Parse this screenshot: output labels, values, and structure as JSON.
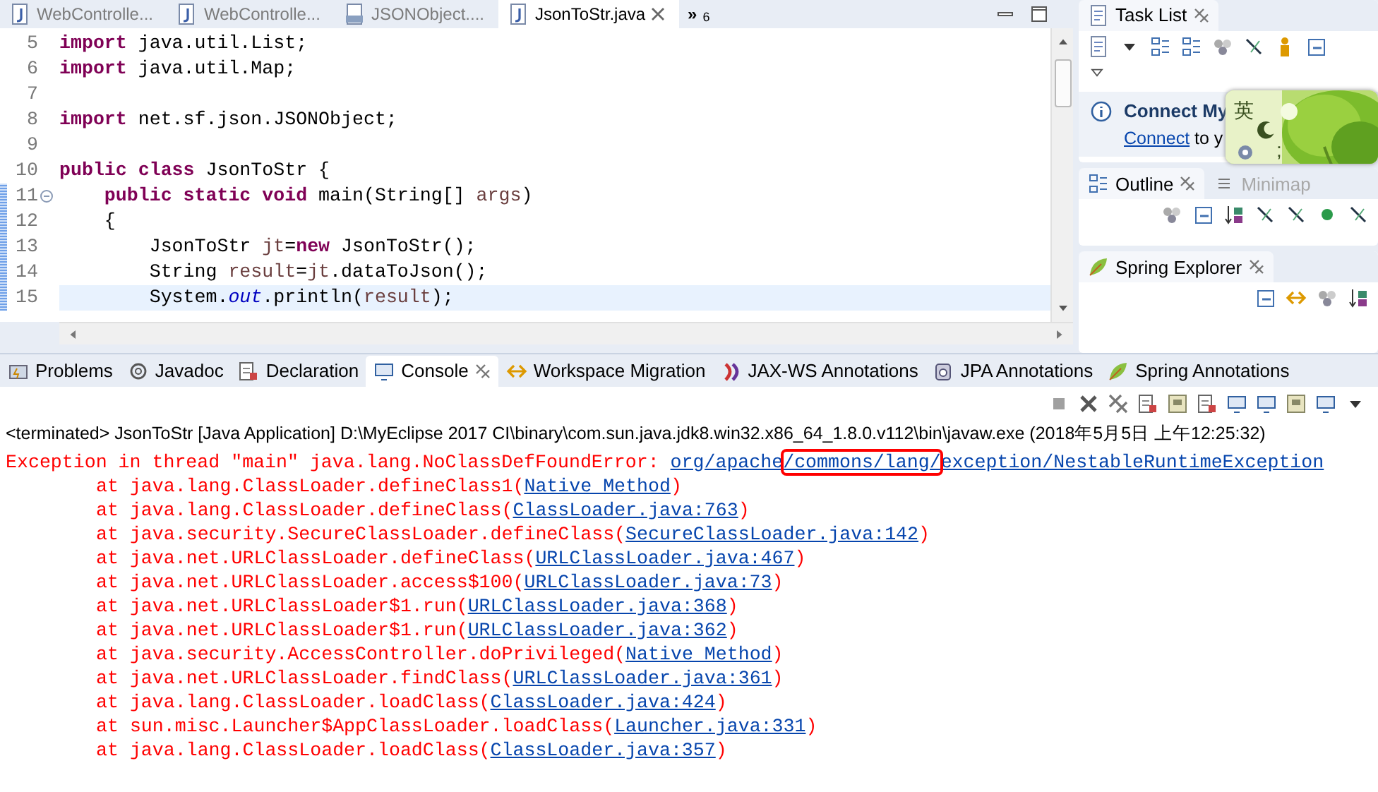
{
  "editor": {
    "tabs": [
      {
        "label": "WebControlle...",
        "selected": false,
        "closable": false
      },
      {
        "label": "WebControlle...",
        "selected": false,
        "closable": false
      },
      {
        "label": "JSONObject....",
        "selected": false,
        "closable": false
      },
      {
        "label": "JsonToStr.java",
        "selected": true,
        "closable": true
      }
    ],
    "overflow": {
      "symbol": "»",
      "count": "6"
    },
    "lines": [
      {
        "number": "5",
        "changed": false,
        "current": false,
        "foldable": false,
        "segments": [
          {
            "text": "import",
            "kind": "keyword"
          },
          {
            "text": " java.util.List;",
            "kind": "plain"
          }
        ]
      },
      {
        "number": "6",
        "changed": false,
        "current": false,
        "foldable": false,
        "segments": [
          {
            "text": "import",
            "kind": "keyword"
          },
          {
            "text": " java.util.Map;",
            "kind": "plain"
          }
        ]
      },
      {
        "number": "7",
        "changed": false,
        "current": false,
        "foldable": false
      },
      {
        "number": "8",
        "changed": false,
        "current": false,
        "foldable": false,
        "segments": [
          {
            "text": "import",
            "kind": "keyword"
          },
          {
            "text": " net.sf.json.JSONObject;",
            "kind": "plain"
          }
        ]
      },
      {
        "number": "9",
        "changed": false,
        "current": false,
        "foldable": false
      },
      {
        "number": "10",
        "changed": false,
        "current": false,
        "foldable": false,
        "segments": [
          {
            "text": "public class",
            "kind": "keyword"
          },
          {
            "text": " JsonToStr {",
            "kind": "plain"
          }
        ]
      },
      {
        "number": "11",
        "changed": true,
        "current": false,
        "foldable": true,
        "segments": [
          {
            "text": "    public static void",
            "kind": "keyword"
          },
          {
            "text": " main(String[] ",
            "kind": "plain"
          },
          {
            "text": "args",
            "kind": "variable"
          },
          {
            "text": ")",
            "kind": "plain"
          }
        ]
      },
      {
        "number": "12",
        "changed": true,
        "current": false,
        "foldable": false,
        "segments": [
          {
            "text": "    {",
            "kind": "plain"
          }
        ]
      },
      {
        "number": "13",
        "changed": true,
        "current": false,
        "foldable": false,
        "segments": [
          {
            "text": "        JsonToStr ",
            "kind": "plain"
          },
          {
            "text": "jt",
            "kind": "variable"
          },
          {
            "text": "=",
            "kind": "plain"
          },
          {
            "text": "new",
            "kind": "keyword"
          },
          {
            "text": " JsonToStr();",
            "kind": "plain"
          }
        ]
      },
      {
        "number": "14",
        "changed": true,
        "current": false,
        "foldable": false,
        "segments": [
          {
            "text": "        String ",
            "kind": "plain"
          },
          {
            "text": "result",
            "kind": "variable"
          },
          {
            "text": "=",
            "kind": "plain"
          },
          {
            "text": "jt",
            "kind": "variable"
          },
          {
            "text": ".dataToJson();",
            "kind": "plain"
          }
        ]
      },
      {
        "number": "15",
        "changed": true,
        "current": true,
        "foldable": false,
        "segments": [
          {
            "text": "        System.",
            "kind": "plain"
          },
          {
            "text": "out",
            "kind": "field"
          },
          {
            "text": ".println(",
            "kind": "plain"
          },
          {
            "text": "result",
            "kind": "variable"
          },
          {
            "text": ");",
            "kind": "plain"
          }
        ]
      }
    ]
  },
  "side": {
    "task_list": {
      "tab": "Task List",
      "connect_title": "Connect My",
      "connect_link": "Connect",
      "connect_rest": "to y"
    },
    "outline_tabs": [
      {
        "label": "Outline",
        "selected": true
      },
      {
        "label": "Minimap",
        "selected": false
      }
    ],
    "spring_explorer": {
      "tab": "Spring Explorer"
    }
  },
  "ime_widget": {
    "label": "英",
    "punct": ";"
  },
  "bottom": {
    "tabs": [
      {
        "label": "Problems",
        "selected": false
      },
      {
        "label": "Javadoc",
        "selected": false
      },
      {
        "label": "Declaration",
        "selected": false
      },
      {
        "label": "Console",
        "selected": true
      },
      {
        "label": "Workspace Migration",
        "selected": false
      },
      {
        "label": "JAX-WS Annotations",
        "selected": false
      },
      {
        "label": "JPA Annotations",
        "selected": false
      },
      {
        "label": "Spring Annotations",
        "selected": false
      }
    ],
    "console_title": "<terminated> JsonToStr [Java Application] D:\\MyEclipse 2017 CI\\binary\\com.sun.java.jdk8.win32.x86_64_1.8.0.v112\\bin\\javaw.exe (2018年5月5日 上午12:25:32)",
    "exception": {
      "text": "Exception in thread \"main\" java.lang.NoClassDefFoundError: ",
      "link": [
        {
          "text": "org/apache",
          "boxed": false
        },
        {
          "text": "/commons/lang/",
          "boxed": true
        },
        {
          "text": "exception/NestableRuntimeException",
          "boxed": false
        }
      ]
    },
    "frames": [
      {
        "text": "at java.lang.ClassLoader.defineClass1(",
        "link": "Native Method",
        "tail": ")"
      },
      {
        "text": "at java.lang.ClassLoader.defineClass(",
        "link": "ClassLoader.java:763",
        "tail": ")"
      },
      {
        "text": "at java.security.SecureClassLoader.defineClass(",
        "link": "SecureClassLoader.java:142",
        "tail": ")"
      },
      {
        "text": "at java.net.URLClassLoader.defineClass(",
        "link": "URLClassLoader.java:467",
        "tail": ")"
      },
      {
        "text": "at java.net.URLClassLoader.access$100(",
        "link": "URLClassLoader.java:73",
        "tail": ")"
      },
      {
        "text": "at java.net.URLClassLoader$1.run(",
        "link": "URLClassLoader.java:368",
        "tail": ")"
      },
      {
        "text": "at java.net.URLClassLoader$1.run(",
        "link": "URLClassLoader.java:362",
        "tail": ")"
      },
      {
        "text": "at java.security.AccessController.doPrivileged(",
        "link": "Native Method",
        "tail": ")"
      },
      {
        "text": "at java.net.URLClassLoader.findClass(",
        "link": "URLClassLoader.java:361",
        "tail": ")"
      },
      {
        "text": "at java.lang.ClassLoader.loadClass(",
        "link": "ClassLoader.java:424",
        "tail": ")"
      },
      {
        "text": "at sun.misc.Launcher$AppClassLoader.loadClass(",
        "link": "Launcher.java:331",
        "tail": ")"
      },
      {
        "text": "at java.lang.ClassLoader.loadClass(",
        "link": "ClassLoader.java:357",
        "tail": ")"
      }
    ]
  }
}
